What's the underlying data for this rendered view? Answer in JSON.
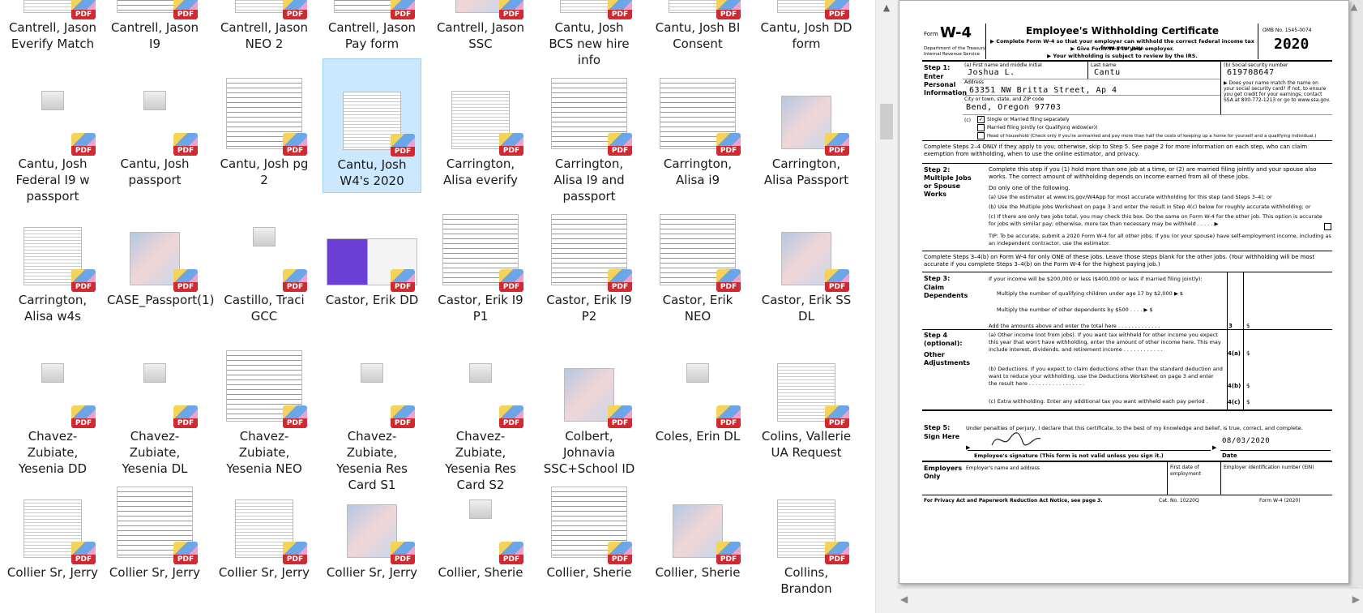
{
  "files": [
    {
      "label": "Cantrell, Jason Everify Match",
      "row": 0,
      "col": 0,
      "thumb": "doc"
    },
    {
      "label": "Cantrell, Jason I9",
      "row": 0,
      "col": 1,
      "thumb": "form"
    },
    {
      "label": "Cantrell, Jason NEO 2",
      "row": 0,
      "col": 2,
      "thumb": "doc"
    },
    {
      "label": "Cantrell, Jason Pay form",
      "row": 0,
      "col": 3,
      "thumb": "form"
    },
    {
      "label": "Cantrell, Jason SSC",
      "row": 0,
      "col": 4,
      "thumb": "photo"
    },
    {
      "label": "Cantu, Josh BCS new hire info",
      "row": 0,
      "col": 5,
      "thumb": "doc"
    },
    {
      "label": "Cantu, Josh BI Consent",
      "row": 0,
      "col": 6,
      "thumb": "doc"
    },
    {
      "label": "Cantu, Josh DD form",
      "row": 0,
      "col": 7,
      "thumb": "doc"
    },
    {
      "label": "Cantu, Josh Federal I9 w passport",
      "row": 1,
      "col": 0,
      "thumb": "tiny"
    },
    {
      "label": "Cantu, Josh passport",
      "row": 1,
      "col": 1,
      "thumb": "tiny"
    },
    {
      "label": "Cantu, Josh pg 2",
      "row": 1,
      "col": 2,
      "thumb": "form"
    },
    {
      "label": "Cantu, Josh W4's 2020",
      "row": 1,
      "col": 3,
      "thumb": "doc",
      "selected": true
    },
    {
      "label": "Carrington, Alisa everify",
      "row": 1,
      "col": 4,
      "thumb": "doc"
    },
    {
      "label": "Carrington, Alisa I9 and passport",
      "row": 1,
      "col": 5,
      "thumb": "form"
    },
    {
      "label": "Carrington, Alisa i9",
      "row": 1,
      "col": 6,
      "thumb": "form"
    },
    {
      "label": "Carrington, Alisa Passport",
      "row": 1,
      "col": 7,
      "thumb": "photo"
    },
    {
      "label": "Carrington, Alisa w4s",
      "row": 2,
      "col": 0,
      "thumb": "doc"
    },
    {
      "label": "CASE_Passport(1)",
      "row": 2,
      "col": 1,
      "thumb": "photo"
    },
    {
      "label": "Castillo, Traci GCC",
      "row": 2,
      "col": 2,
      "thumb": "tiny"
    },
    {
      "label": "Castor, Erik DD",
      "row": 2,
      "col": 3,
      "thumb": "purple"
    },
    {
      "label": "Castor, Erik I9 P1",
      "row": 2,
      "col": 4,
      "thumb": "form"
    },
    {
      "label": "Castor, Erik I9 P2",
      "row": 2,
      "col": 5,
      "thumb": "form"
    },
    {
      "label": "Castor, Erik NEO",
      "row": 2,
      "col": 6,
      "thumb": "form"
    },
    {
      "label": "Castor, Erik SS DL",
      "row": 2,
      "col": 7,
      "thumb": "photo"
    },
    {
      "label": "Chavez-Zubiate, Yesenia DD",
      "row": 3,
      "col": 0,
      "thumb": "tiny"
    },
    {
      "label": "Chavez-Zubiate, Yesenia DL",
      "row": 3,
      "col": 1,
      "thumb": "tiny"
    },
    {
      "label": "Chavez-Zubiate, Yesenia NEO",
      "row": 3,
      "col": 2,
      "thumb": "form"
    },
    {
      "label": "Chavez-Zubiate, Yesenia Res Card S1",
      "row": 3,
      "col": 3,
      "thumb": "tiny"
    },
    {
      "label": "Chavez-Zubiate, Yesenia Res Card S2",
      "row": 3,
      "col": 4,
      "thumb": "tiny"
    },
    {
      "label": "Colbert, Johnavia SSC+School ID",
      "row": 3,
      "col": 5,
      "thumb": "photo"
    },
    {
      "label": "Coles, Erin DL",
      "row": 3,
      "col": 6,
      "thumb": "tiny"
    },
    {
      "label": "Colins, Vallerie UA Request",
      "row": 3,
      "col": 7,
      "thumb": "doc"
    },
    {
      "label": "Collier Sr, Jerry",
      "row": 4,
      "col": 0,
      "thumb": "doc"
    },
    {
      "label": "Collier Sr, Jerry",
      "row": 4,
      "col": 1,
      "thumb": "form"
    },
    {
      "label": "Collier Sr, Jerry",
      "row": 4,
      "col": 2,
      "thumb": "doc"
    },
    {
      "label": "Collier Sr, Jerry",
      "row": 4,
      "col": 3,
      "thumb": "photo"
    },
    {
      "label": "Collier, Sherie",
      "row": 4,
      "col": 4,
      "thumb": "tiny"
    },
    {
      "label": "Collier, Sherie",
      "row": 4,
      "col": 5,
      "thumb": "form"
    },
    {
      "label": "Collier, Sherie",
      "row": 4,
      "col": 6,
      "thumb": "photo"
    },
    {
      "label": "Collins, Brandon",
      "row": 4,
      "col": 7,
      "thumb": "doc"
    }
  ],
  "pdf_badge": "PDF",
  "scroll": {
    "up": "▲",
    "down": "▼",
    "left": "◀",
    "right": "▶"
  },
  "w4": {
    "form_word": "Form",
    "form_no": "W-4",
    "dept": "Department of the Treasury Internal Revenue Service",
    "title": "Employee's Withholding Certificate",
    "instr1": "▶ Complete Form W-4 so that your employer can withhold the correct federal income tax from your pay.",
    "instr2": "▶ Give Form W-4 to your employer.",
    "instr3": "▶ Your withholding is subject to review by the IRS.",
    "omb": "OMB No. 1545-0074",
    "year": "2020",
    "step1": "Step 1:",
    "step1_sub": "Enter Personal Information",
    "lbl_a": "(a)  First name and middle initial",
    "lbl_last": "Last name",
    "lbl_b": "(b)  Social security number",
    "first_name": "Joshua L.",
    "last_name": "Cantu",
    "ssn": "619708647",
    "lbl_addr": "Address",
    "address": "63351 NW Britta Street, Ap 4",
    "lbl_city": "City or town, state, and ZIP code",
    "city": "Bend, Oregon 97703",
    "ssa_note": "▶ Does your name match the name on your social security card? If not, to ensure you get credit for your earnings, contact SSA at 800-772-1213 or go to www.ssa.gov.",
    "lbl_c": "(c)",
    "check_mark": "✓",
    "fs_single": "Single or Married filing separately",
    "fs_joint": "Married filing jointly (or Qualifying widow(er))",
    "fs_hoh": "Head of household (Check only if you're unmarried and pay more than half the costs of keeping up a home for yourself and a qualifying individual.)",
    "complete_24": "Complete Steps 2–4 ONLY if they apply to you; otherwise, skip to Step 5. See page 2 for more information on each step, who can claim exemption from withholding, when to use the online estimator, and privacy.",
    "step2": "Step 2:",
    "step2_sub": "Multiple Jobs or Spouse Works",
    "step2_text": "Complete this step if you (1) hold more than one job at a time, or (2) are married filing jointly and your spouse also works. The correct amount of withholding depends on income earned from all of these jobs.",
    "do_one": "Do only one of the following.",
    "opt_a": "(a)  Use the estimator at www.irs.gov/W4App for most accurate withholding for this step (and Steps 3–4); or",
    "opt_b": "(b)  Use the Multiple Jobs Worksheet on page 3 and enter the result in Step 4(c) below for roughly accurate withholding; or",
    "opt_c": "(c)  If there are only two jobs total, you may check this box. Do the same on Form W-4 for the other job. This option is accurate for jobs with similar pay; otherwise, more tax than necessary may be withheld  .  .  .  .  .  ▶",
    "tip": "TIP: To be accurate, submit a 2020 Form W-4 for all other jobs. If you (or your spouse) have self-employment income, including as an independent contractor, use the estimator.",
    "complete_34": "Complete Steps 3–4(b) on Form W-4 for only ONE of these jobs. Leave those steps blank for the other jobs. (Your withholding will be most accurate if you complete Steps 3–4(b) on the Form W-4 for the highest paying job.)",
    "step3": "Step 3:",
    "step3_sub": "Claim Dependents",
    "step3_intro": "If your income will be $200,000 or less ($400,000 or less if married filing jointly):",
    "step3_children": "Multiply the number of qualifying children under age 17 by $2,000 ▶  $",
    "step3_other": "Multiply the number of other dependents by $500   .  .  .  .  ▶  $",
    "step3_total": "Add the amounts above and enter the total here  .  .  .  .  .  .  .  .  .  .  .  .  .",
    "line3": "3",
    "dollar": "$",
    "step4": "Step 4 (optional):",
    "step4_sub": "Other Adjustments",
    "step4a": "(a)  Other income (not from jobs). If you want tax withheld for other income you expect this year that won't have withholding, enter the amount of other income here. This may include interest, dividends, and retirement income  .  .  .  .  .  .  .  .  .  .  .  .",
    "line4a": "4(a)",
    "step4b": "(b)  Deductions. If you expect to claim deductions other than the standard deduction and want to reduce your withholding, use the Deductions Worksheet on page 3 and enter the result here  .  .  .  .  .  .  .  .  .  .  .  .  .  .  .  .  .",
    "line4b": "4(b)",
    "step4c": "(c)  Extra withholding. Enter any additional tax you want withheld each pay period  .",
    "line4c": "4(c)",
    "step5": "Step 5:",
    "step5_sub": "Sign Here",
    "perjury": "Under penalties of perjury, I declare that this certificate, to the best of my knowledge and belief, is true, correct, and complete.",
    "sig_label": "Employee's signature (This form is not valid unless you sign it.)",
    "sign_date": "08/03/2020",
    "date_label": "Date",
    "emp_only": "Employers Only",
    "emp_name": "Employer's name and address",
    "first_date": "First date of employment",
    "ein": "Employer identification number (EIN)",
    "footer_privacy": "For Privacy Act and Paperwork Reduction Act Notice, see page 3.",
    "footer_cat": "Cat. No. 10220Q",
    "footer_form": "Form W-4 (2020)"
  }
}
